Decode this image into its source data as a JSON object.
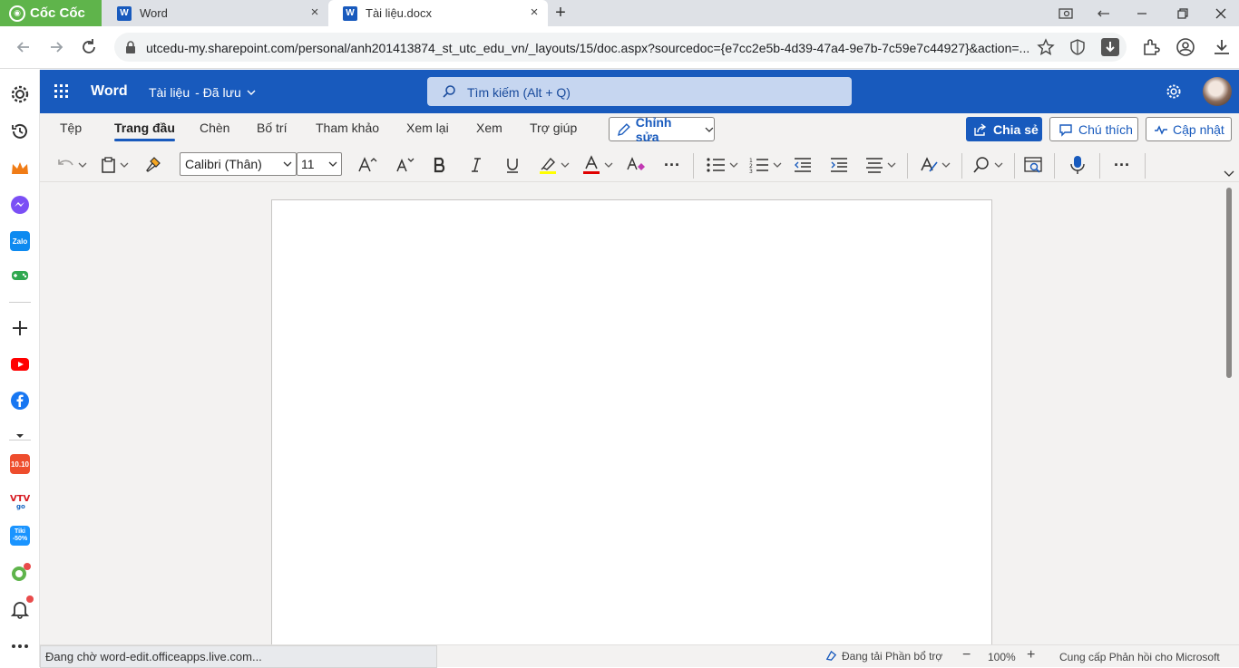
{
  "browser": {
    "brand": "Cốc Cốc",
    "tabs": [
      {
        "title": "Word"
      },
      {
        "title": "Tài liệu.docx"
      }
    ],
    "url": "utcedu-my.sharepoint.com/personal/anh201413874_st_utc_edu_vn/_layouts/15/doc.aspx?sourcedoc={e7cc2e5b-4d39-47a4-9e7b-7c59e7c44927}&action=...",
    "sidebar_badges": {
      "shopee": "10.10",
      "tiki": "Tiki -50%",
      "zalo": "Zalo"
    }
  },
  "word": {
    "app_name": "Word",
    "doc_title": "Tài liệu",
    "save_status": "- Đã lưu",
    "search_placeholder": "Tìm kiếm (Alt + Q)",
    "ribbon_tabs": [
      "Tệp",
      "Trang đầu",
      "Chèn",
      "Bố trí",
      "Tham khảo",
      "Xem lại",
      "Xem",
      "Trợ giúp"
    ],
    "active_tab": "Trang đầu",
    "edit_mode": "Chỉnh sửa",
    "share": "Chia sẻ",
    "comments": "Chú thích",
    "catch_up": "Cập nhật",
    "font_name": "Calibri (Thân)",
    "font_size": "11",
    "more": "···"
  },
  "status": {
    "loading": "Đang chờ word-edit.officeapps.live.com...",
    "addins": "Đang tải Phần bổ trợ",
    "zoom": "100%",
    "feedback": "Cung cấp Phản hồi cho Microsoft"
  },
  "colors": {
    "word_blue": "#185abd",
    "highlight": "#ffff00",
    "font_color": "#e00000",
    "coccoc_green": "#5fb44b"
  }
}
